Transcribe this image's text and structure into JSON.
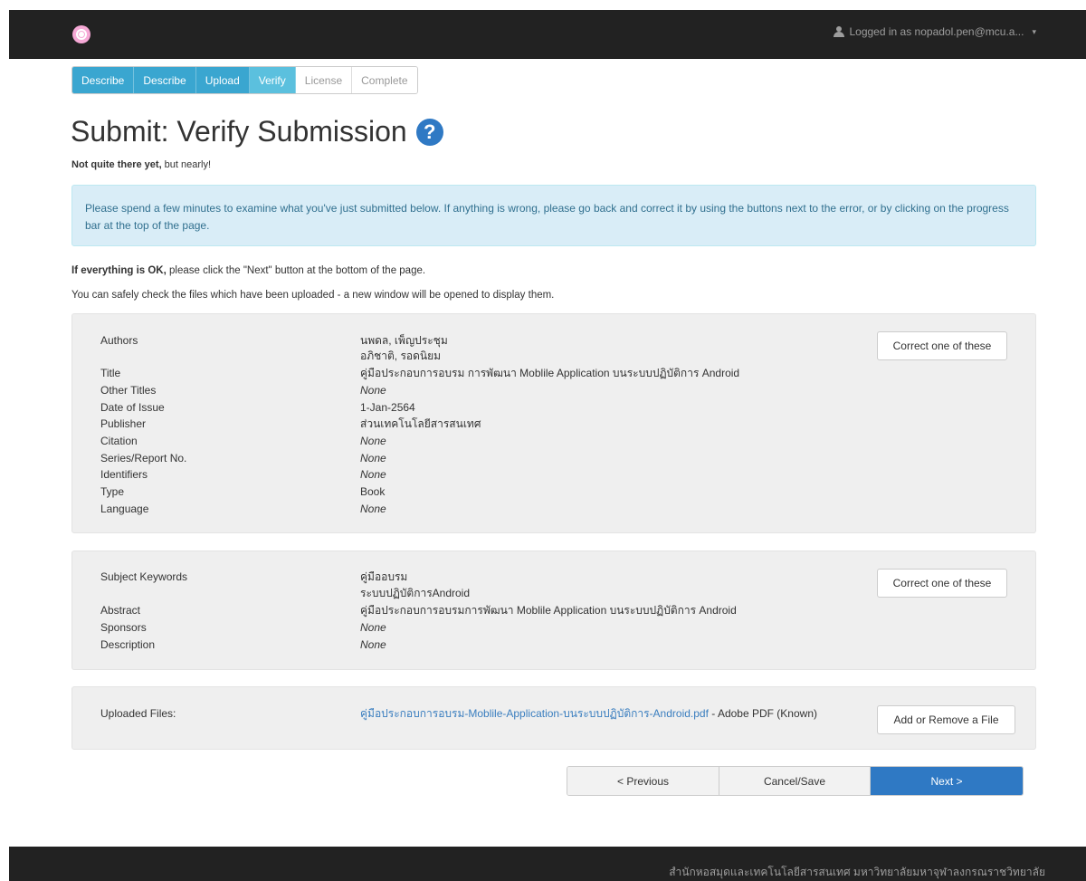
{
  "navbar": {
    "user_label": "Logged in as nopadol.pen@mcu.a...",
    "caret": "▾"
  },
  "progress": {
    "steps": [
      {
        "label": "Describe"
      },
      {
        "label": "Describe"
      },
      {
        "label": "Upload"
      },
      {
        "label": "Verify"
      },
      {
        "label": "License"
      },
      {
        "label": "Complete"
      }
    ]
  },
  "page": {
    "title": "Submit: Verify Submission",
    "help_glyph": "?",
    "subtitle_bold": "Not quite there yet,",
    "subtitle_rest": " but nearly!",
    "alert": "Please spend a few minutes to examine what you've just submitted below. If anything is wrong, please go back and correct it by using the buttons next to the error, or by clicking on the progress bar at the top of the page.",
    "ok_bold": "If everything is OK,",
    "ok_rest": " please click the \"Next\" button at the bottom of the page.",
    "safe_line": "You can safely check the files which have been uploaded - a new window will be opened to display them."
  },
  "section1": {
    "button": "Correct one of these",
    "authors_label": "Authors",
    "author1": "นพดล, เพ็ญประชุม",
    "author2": "อภิชาติ, รอดนิยม",
    "title_label": "Title",
    "title_value": "คู่มือประกอบการอบรม การพัฒนา Moblile Application บนระบบปฏิบัติการ Android",
    "other_titles_label": "Other Titles",
    "other_titles_value": "None",
    "date_label": "Date of Issue",
    "date_value": "1-Jan-2564",
    "publisher_label": "Publisher",
    "publisher_value": "ส่วนเทคโนโลยีสารสนเทศ",
    "citation_label": "Citation",
    "citation_value": "None",
    "series_label": "Series/Report No.",
    "series_value": "None",
    "identifiers_label": "Identifiers",
    "identifiers_value": "None",
    "type_label": "Type",
    "type_value": "Book",
    "language_label": "Language",
    "language_value": "None"
  },
  "section2": {
    "button": "Correct one of these",
    "keywords_label": "Subject Keywords",
    "keyword1": "คู่มืออบรม",
    "keyword2": "ระบบปฏิบัติการAndroid",
    "abstract_label": "Abstract",
    "abstract_value": "คู่มือประกอบการอบรมการพัฒนา Moblile Application บนระบบปฏิบัติการ Android",
    "sponsors_label": "Sponsors",
    "sponsors_value": "None",
    "description_label": "Description",
    "description_value": "None"
  },
  "section3": {
    "label": "Uploaded Files:",
    "file_link": "คู่มือประกอบการอบรม-Moblile-Application-บนระบบปฏิบัติการ-Android.pdf",
    "file_format": " - Adobe PDF (Known)",
    "button": "Add or Remove a File"
  },
  "actions": {
    "previous": "< Previous",
    "cancel": "Cancel/Save",
    "next": "Next >"
  },
  "footer": {
    "text": "สำนักหอสมุดและเทคโนโลยีสารสนเทศ มหาวิทยาลัยมหาจุฬาลงกรณราชวิทยาลัย"
  },
  "colors": {
    "navbar_bg": "#222222",
    "progress_done": "#3aa6d0",
    "progress_current": "#5bc0de",
    "alert_bg": "#d9edf7",
    "alert_text": "#31708f",
    "primary": "#2f79c4",
    "link": "#3a7ebf"
  }
}
